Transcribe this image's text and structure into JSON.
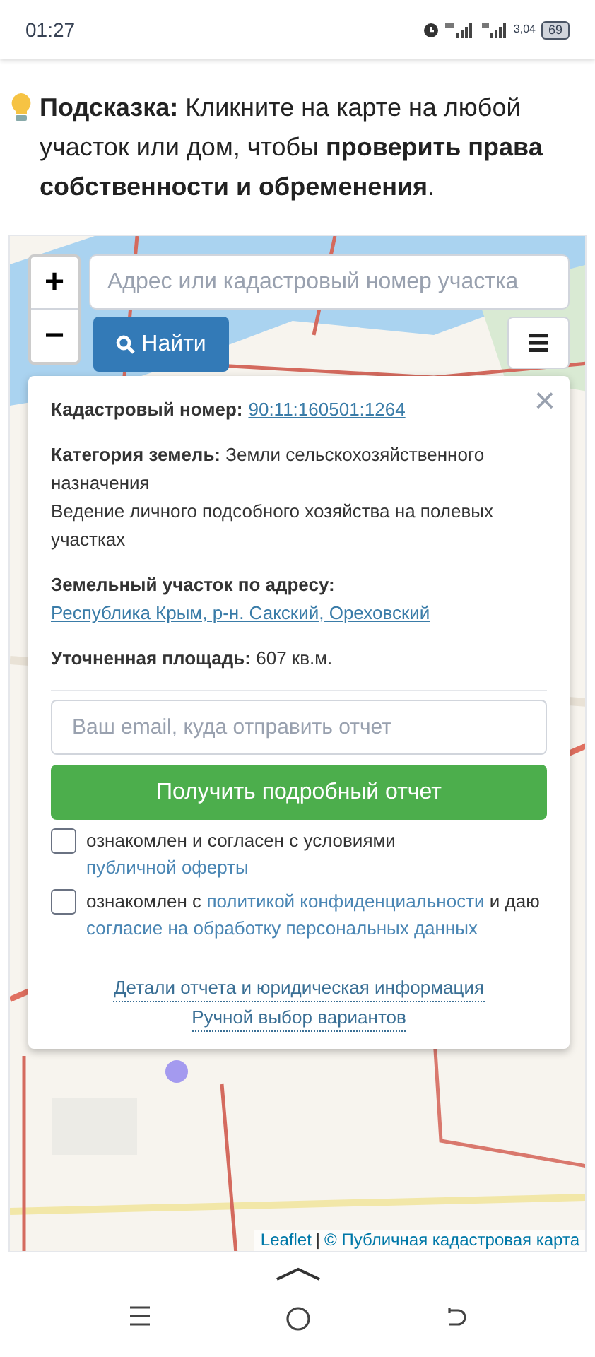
{
  "status_bar": {
    "time": "01:27",
    "network_speed": "3,04",
    "battery": "69"
  },
  "hint": {
    "text": "**Подсказка:** Кликните на карте на любой участок или дом, чтобы **проверить права собственности и обременения**."
  },
  "map": {
    "kind": "picture",
    "zoom": {
      "in": "+",
      "out": "−"
    },
    "search": {
      "placeholder": "Адрес или кадастровый номер участка",
      "button": "Найти"
    },
    "popup": {
      "close": "×",
      "fields": [
        {
          "label": "Кадастровый номер:",
          "value": "90:11:160501:1264",
          "kind": "link"
        },
        {
          "label": "Категория земель:",
          "value": "Земли сельскохозяйственного назначения",
          "extra": "Ведение личного подсобного хозяйства на полевых участках",
          "kind": "text"
        },
        {
          "label": "Земельный участок по адресу:",
          "value": "Республика Крым, р-н. Сакский, Ореховский",
          "kind": "link"
        },
        {
          "label": "Уточненная площадь:",
          "value": "607 кв.м.",
          "kind": "text"
        }
      ],
      "email": {
        "placeholder": "Ваш email, куда отправить отчет"
      },
      "submit": "Получить подробный отчет",
      "consents": [
        {
          "parts": [
            {
              "text": "ознакомлен и согласен с условиями ",
              "link": false
            },
            {
              "text": "публичной оферты",
              "link": true
            }
          ],
          "checked": false
        },
        {
          "parts": [
            {
              "text": "ознакомлен с ",
              "link": false
            },
            {
              "text": "политикой конфиденциальности",
              "link": true
            },
            {
              "text": " и даю ",
              "link": false
            },
            {
              "text": "согласие на обработку персональных данных",
              "link": true
            }
          ],
          "checked": false
        }
      ],
      "footer_links": [
        "Детали отчета и юридическая информация",
        "Ручной выбор вариантов"
      ]
    },
    "attribution": {
      "leaflet": "Leaflet",
      "separator": "|",
      "source": "© Публичная кадастровая карта"
    }
  }
}
